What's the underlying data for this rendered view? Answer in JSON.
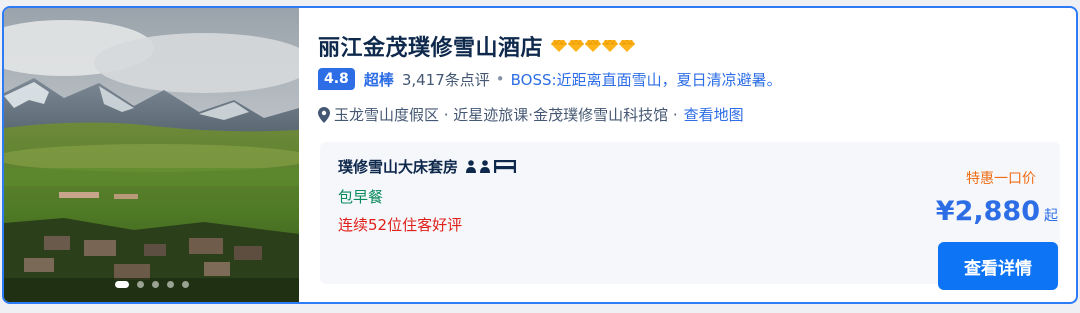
{
  "hotel": {
    "name": "丽江金茂璞修雪山酒店",
    "diamond_count": 5,
    "diamond_color": "#ffb31a",
    "score": "4.8",
    "rating_word": "超棒",
    "review_count": "3,417条点评",
    "separator": "•",
    "boss_quote": "BOSS:近距离直面雪山，夏日清凉避暑。",
    "location": "玉龙雪山度假区 · 近星迹旅课·金茂璞修雪山科技馆 ·",
    "map_link": "查看地图"
  },
  "room": {
    "name": "璞修雪山大床套房",
    "icons": [
      "person-icon",
      "person-icon",
      "bed-icon"
    ],
    "breakfast": "包早餐",
    "review_streak": "连续52位住客好评"
  },
  "pricing": {
    "deal_label": "特惠一口价",
    "price": "¥2,880",
    "price_suffix": "起",
    "cta": "查看详情"
  },
  "gallery": {
    "slide_count": 5,
    "active_slide": 1
  },
  "colors": {
    "accent": "#2d6ee6",
    "button": "#0d74f5",
    "deal": "#f06e16",
    "breakfast": "#0a8b5c",
    "streak": "#e0201a",
    "title": "#0f294d"
  }
}
